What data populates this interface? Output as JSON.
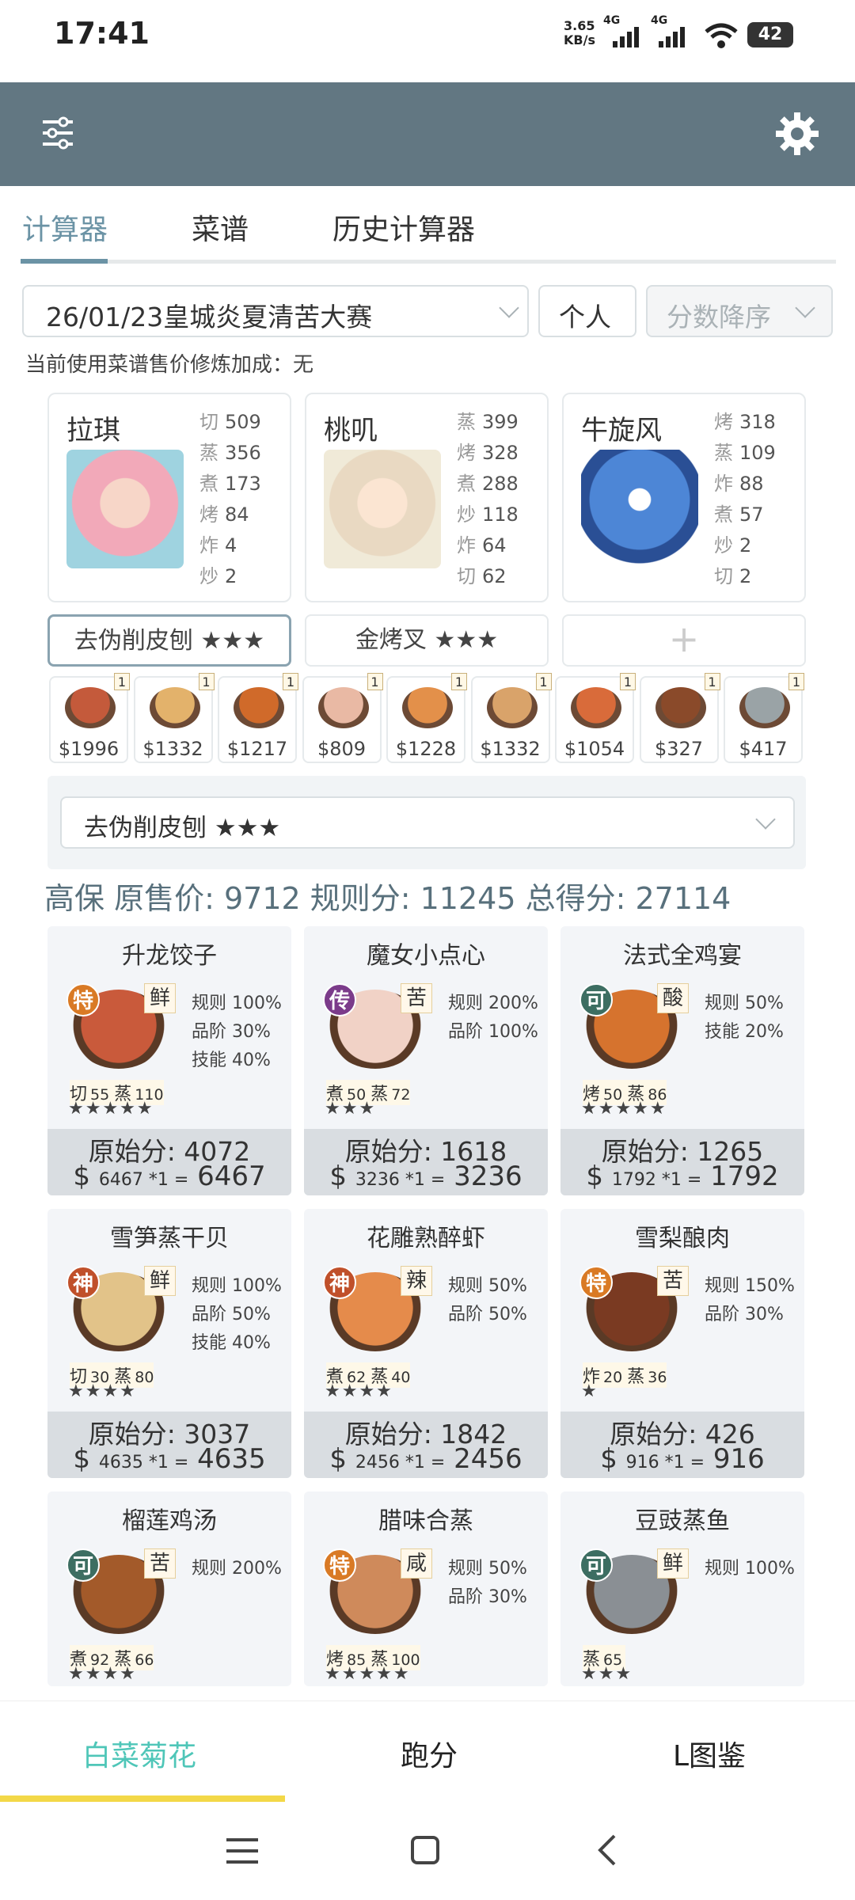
{
  "status": {
    "time": "17:41",
    "speed_num": "3.65",
    "speed_unit": "KB/s",
    "net1": "4G",
    "net2": "4G",
    "battery": "42"
  },
  "tabs": [
    "计算器",
    "菜谱",
    "历史计算器"
  ],
  "controls": {
    "contest": "26/01/23皇城炎夏清苦大赛",
    "mode": "个人",
    "sort": "分数降序"
  },
  "notice": "当前使用菜谱售价修炼加成：无",
  "chefs": [
    {
      "name": "拉琪",
      "stats": [
        [
          "切",
          "509"
        ],
        [
          "蒸",
          "356"
        ],
        [
          "煮",
          "173"
        ],
        [
          "烤",
          "84"
        ],
        [
          "炸",
          "4"
        ],
        [
          "炒",
          "2"
        ]
      ]
    },
    {
      "name": "桃叽",
      "stats": [
        [
          "蒸",
          "399"
        ],
        [
          "烤",
          "328"
        ],
        [
          "煮",
          "288"
        ],
        [
          "炒",
          "118"
        ],
        [
          "炸",
          "64"
        ],
        [
          "切",
          "62"
        ]
      ]
    },
    {
      "name": "牛旋风",
      "stats": [
        [
          "烤",
          "318"
        ],
        [
          "蒸",
          "109"
        ],
        [
          "炸",
          "88"
        ],
        [
          "煮",
          "57"
        ],
        [
          "炒",
          "2"
        ],
        [
          "切",
          "2"
        ]
      ]
    }
  ],
  "equips": [
    "去伪削皮刨 ★★★",
    "金烤叉 ★★★",
    "+"
  ],
  "dishes": [
    {
      "price": "$1996",
      "qty": "1"
    },
    {
      "price": "$1332",
      "qty": "1"
    },
    {
      "price": "$1217",
      "qty": "1"
    },
    {
      "price": "$809",
      "qty": "1"
    },
    {
      "price": "$1228",
      "qty": "1"
    },
    {
      "price": "$1332",
      "qty": "1"
    },
    {
      "price": "$1054",
      "qty": "1"
    },
    {
      "price": "$327",
      "qty": "1"
    },
    {
      "price": "$417",
      "qty": "1"
    }
  ],
  "equip_select": "去伪削皮刨 ★★★",
  "summary": "高保 原售价: 9712 规则分: 11245 总得分: 27114",
  "recipes": [
    {
      "name": "升龙饺子",
      "badge": "特",
      "flavor": "鲜",
      "rules": [
        "规则 100%",
        "品阶 30%",
        "技能 40%"
      ],
      "s1": "切",
      "v1": "55",
      "s2": "蒸",
      "v2": "110",
      "stars": "★★★★★",
      "raw": "原始分: 4072",
      "calc_pre": "$",
      "calc_small": "6467 *1 =",
      "calc_total": "6467"
    },
    {
      "name": "魔女小点心",
      "badge": "传",
      "flavor": "苦",
      "rules": [
        "规则 200%",
        "品阶 100%"
      ],
      "s1": "煮",
      "v1": "50",
      "s2": "蒸",
      "v2": "72",
      "stars": "★★★",
      "raw": "原始分: 1618",
      "calc_pre": "$",
      "calc_small": "3236 *1 =",
      "calc_total": "3236"
    },
    {
      "name": "法式全鸡宴",
      "badge": "可",
      "flavor": "酸",
      "rules": [
        "规则 50%",
        "技能 20%"
      ],
      "s1": "烤",
      "v1": "50",
      "s2": "蒸",
      "v2": "86",
      "stars": "★★★★★",
      "raw": "原始分: 1265",
      "calc_pre": "$",
      "calc_small": "1792 *1 =",
      "calc_total": "1792"
    },
    {
      "name": "雪笋蒸干贝",
      "badge": "神",
      "flavor": "鲜",
      "rules": [
        "规则 100%",
        "品阶 50%",
        "技能 40%"
      ],
      "s1": "切",
      "v1": "30",
      "s2": "蒸",
      "v2": "80",
      "stars": "★★★★",
      "raw": "原始分: 3037",
      "calc_pre": "$",
      "calc_small": "4635 *1 =",
      "calc_total": "4635"
    },
    {
      "name": "花雕熟醉虾",
      "badge": "神",
      "flavor": "辣",
      "rules": [
        "规则 50%",
        "品阶 50%"
      ],
      "s1": "煮",
      "v1": "62",
      "s2": "蒸",
      "v2": "40",
      "stars": "★★★★",
      "raw": "原始分: 1842",
      "calc_pre": "$",
      "calc_small": "2456 *1 =",
      "calc_total": "2456"
    },
    {
      "name": "雪梨酿肉",
      "badge": "特",
      "flavor": "苦",
      "rules": [
        "规则 150%",
        "品阶 30%"
      ],
      "s1": "炸",
      "v1": "20",
      "s2": "蒸",
      "v2": "36",
      "stars": "★",
      "raw": "原始分: 426",
      "calc_pre": "$",
      "calc_small": "916 *1 =",
      "calc_total": "916"
    },
    {
      "name": "榴莲鸡汤",
      "badge": "可",
      "flavor": "苦",
      "rules": [
        "规则 200%"
      ],
      "s1": "煮",
      "v1": "92",
      "s2": "蒸",
      "v2": "66",
      "stars": "★★★★",
      "raw": "",
      "calc_pre": "",
      "calc_small": "",
      "calc_total": ""
    },
    {
      "name": "腊味合蒸",
      "badge": "特",
      "flavor": "咸",
      "rules": [
        "规则 50%",
        "品阶 30%"
      ],
      "s1": "烤",
      "v1": "85",
      "s2": "蒸",
      "v2": "100",
      "stars": "★★★★★",
      "raw": "",
      "calc_pre": "",
      "calc_small": "",
      "calc_total": ""
    },
    {
      "name": "豆豉蒸鱼",
      "badge": "可",
      "flavor": "鲜",
      "rules": [
        "规则 100%"
      ],
      "s1": "蒸",
      "v1": "65",
      "s2": "",
      "v2": "",
      "stars": "★★★",
      "raw": "",
      "calc_pre": "",
      "calc_small": "",
      "calc_total": ""
    }
  ],
  "badge_colors": {
    "特": "#d97a25",
    "传": "#7b3b8a",
    "可": "#3d6e62",
    "神": "#c0502a"
  },
  "bottom_nav": [
    "白菜菊花",
    "跑分",
    "L图鉴"
  ],
  "colors": {
    "header": "#627782",
    "accent": "#6b93a5",
    "active_nav": "#4fc6b8",
    "nav_underline": "#f3d848"
  }
}
